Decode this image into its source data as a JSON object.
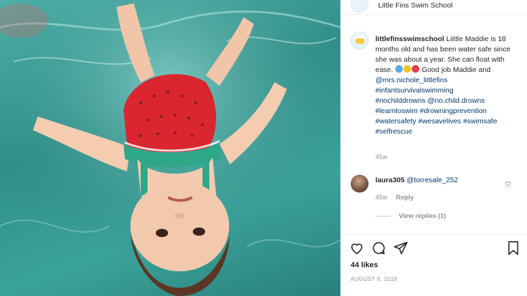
{
  "header": {
    "account_name": "Little Fins Swim School"
  },
  "post": {
    "username": "littlefinsswimschool",
    "caption_lines": [
      "Liittle Maddie is",
      "18 months old and has been water",
      "safe since she was about a year. She",
      "can float with ease.",
      "Good",
      "job Maddie and"
    ],
    "mentions_and_tags": [
      "@mrs.nichole_littlefins",
      "#infantsurvivalswimming",
      "#nochilddrowns",
      "@no.child.drowns",
      "#learntoswim",
      "#drowningprevention",
      "#watersafety",
      "#wesavelives",
      "#swimsafe",
      "#selfrescue"
    ],
    "emoji": [
      "flipper-emoji",
      "sparkle-emoji",
      "heart-emoji"
    ],
    "time_ago": "45w"
  },
  "comment": {
    "username": "laura305",
    "mention": "@torresale_252",
    "time_ago": "45w",
    "reply_label": "Reply",
    "view_replies_label": "View replies (1)"
  },
  "footer": {
    "likes": "44 likes",
    "date": "AUGUST 9, 2019"
  },
  "colors": {
    "link": "#00376b",
    "meta": "#8e8e8e",
    "text": "#262626",
    "water": "#3aa39b"
  },
  "icons": [
    "heart-icon",
    "comment-icon",
    "share-icon",
    "bookmark-icon",
    "small-heart-icon"
  ]
}
